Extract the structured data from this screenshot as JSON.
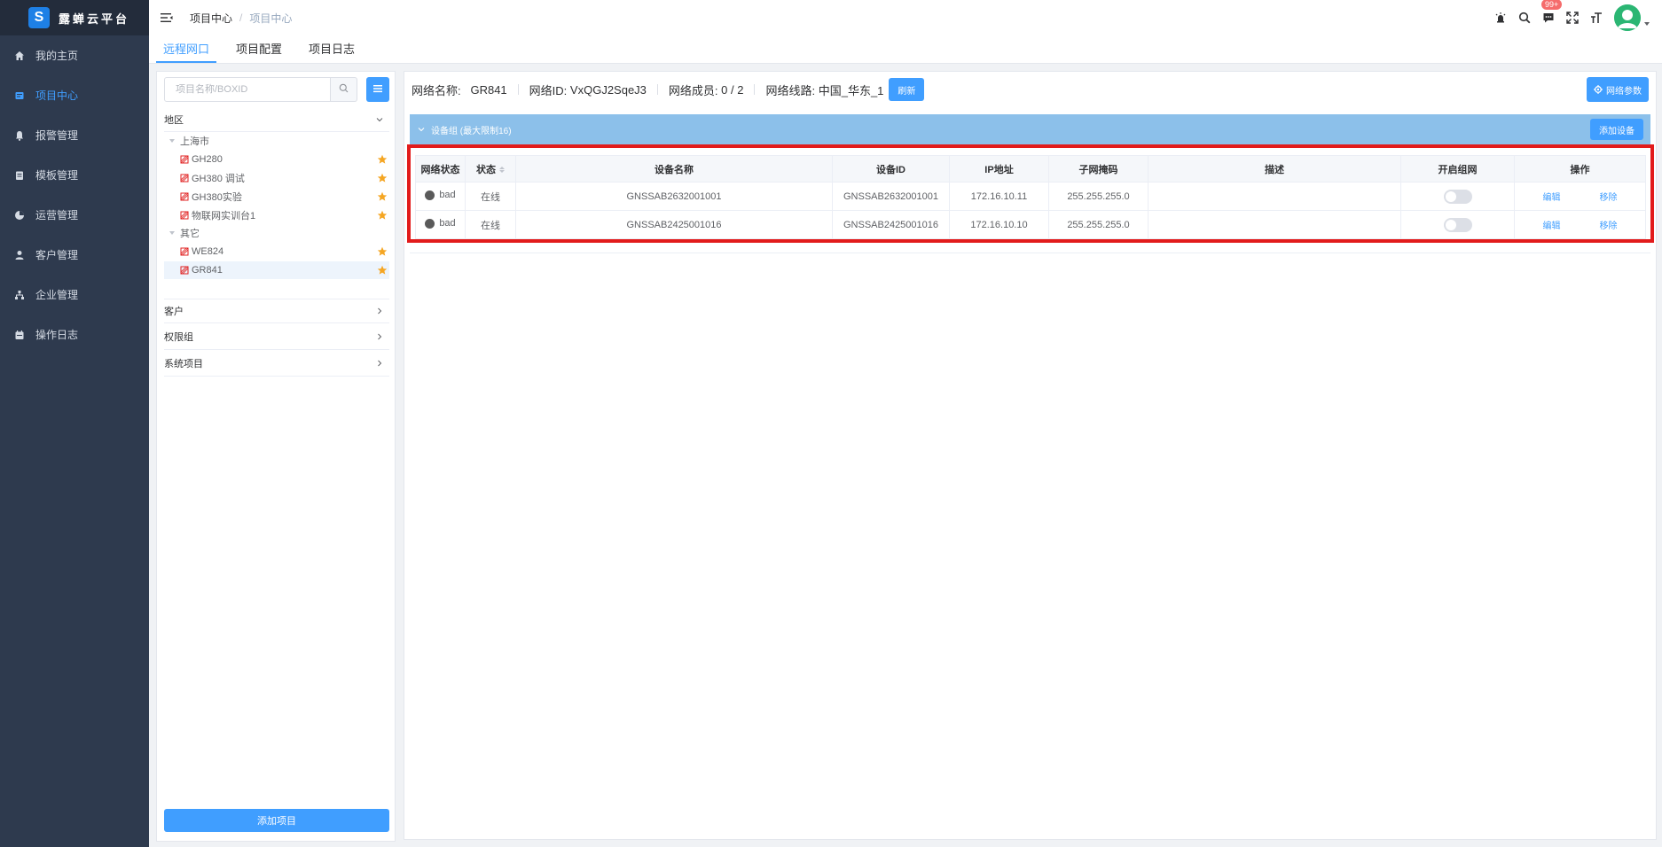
{
  "app": {
    "logo_letter": "S",
    "name": "露蝉云平台"
  },
  "sidebar": {
    "items": [
      {
        "label": "我的主页",
        "icon": "home-icon"
      },
      {
        "label": "项目中心",
        "icon": "project-icon",
        "active": true
      },
      {
        "label": "报警管理",
        "icon": "bell-icon"
      },
      {
        "label": "模板管理",
        "icon": "template-icon"
      },
      {
        "label": "运营管理",
        "icon": "pie-chart-icon"
      },
      {
        "label": "客户管理",
        "icon": "user-icon"
      },
      {
        "label": "企业管理",
        "icon": "org-icon"
      },
      {
        "label": "操作日志",
        "icon": "log-icon"
      }
    ]
  },
  "header": {
    "breadcrumb": [
      "项目中心",
      "项目中心"
    ],
    "notification_badge": "99+"
  },
  "tabs": [
    {
      "label": "远程网口",
      "active": true
    },
    {
      "label": "项目配置"
    },
    {
      "label": "项目日志"
    }
  ],
  "left_panel": {
    "search_placeholder": "项目名称/BOXID",
    "region_title": "地区",
    "tree": [
      {
        "label": "上海市",
        "type": "group"
      },
      {
        "label": "GH280",
        "type": "device"
      },
      {
        "label": "GH380 调试",
        "type": "device"
      },
      {
        "label": "GH380实验",
        "type": "device"
      },
      {
        "label": "物联网实训台1",
        "type": "device"
      },
      {
        "label": "其它",
        "type": "group"
      },
      {
        "label": "WE824",
        "type": "device"
      },
      {
        "label": "GR841",
        "type": "device",
        "selected": true
      }
    ],
    "sections": [
      "客户",
      "权限组",
      "系统项目"
    ],
    "add_project_label": "添加项目"
  },
  "network_info": {
    "name_label": "网络名称:",
    "name_value": "GR841",
    "id_label": "网络ID:",
    "id_value": "VxQGJ2SqeJ3",
    "members_label": "网络成员:",
    "members_value": "0 / 2",
    "route_label": "网络线路:",
    "route_value": "中国_华东_1",
    "refresh_label": "刷新",
    "params_label": "网络参数"
  },
  "device_group": {
    "title": "设备组 (最大限制16)",
    "add_device_label": "添加设备"
  },
  "device_table": {
    "columns": [
      "网络状态",
      "状态",
      "设备名称",
      "设备ID",
      "IP地址",
      "子网掩码",
      "描述",
      "开启组网",
      "操作"
    ],
    "rows": [
      {
        "net_status": "bad",
        "status": "在线",
        "name": "GNSSAB2632001001",
        "id": "GNSSAB2632001001",
        "ip": "172.16.10.11",
        "mask": "255.255.255.0",
        "desc": "",
        "enabled": false,
        "edit": "编辑",
        "remove": "移除"
      },
      {
        "net_status": "bad",
        "status": "在线",
        "name": "GNSSAB2425001016",
        "id": "GNSSAB2425001016",
        "ip": "172.16.10.10",
        "mask": "255.255.255.0",
        "desc": "",
        "enabled": false,
        "edit": "编辑",
        "remove": "移除"
      }
    ]
  },
  "colors": {
    "primary": "#409eff",
    "sidebar_bg": "#2e3a4e",
    "online": "#67c23a",
    "highlight": "#e21b1b",
    "star": "#f5a623",
    "group_bar": "#8cc0ea"
  }
}
